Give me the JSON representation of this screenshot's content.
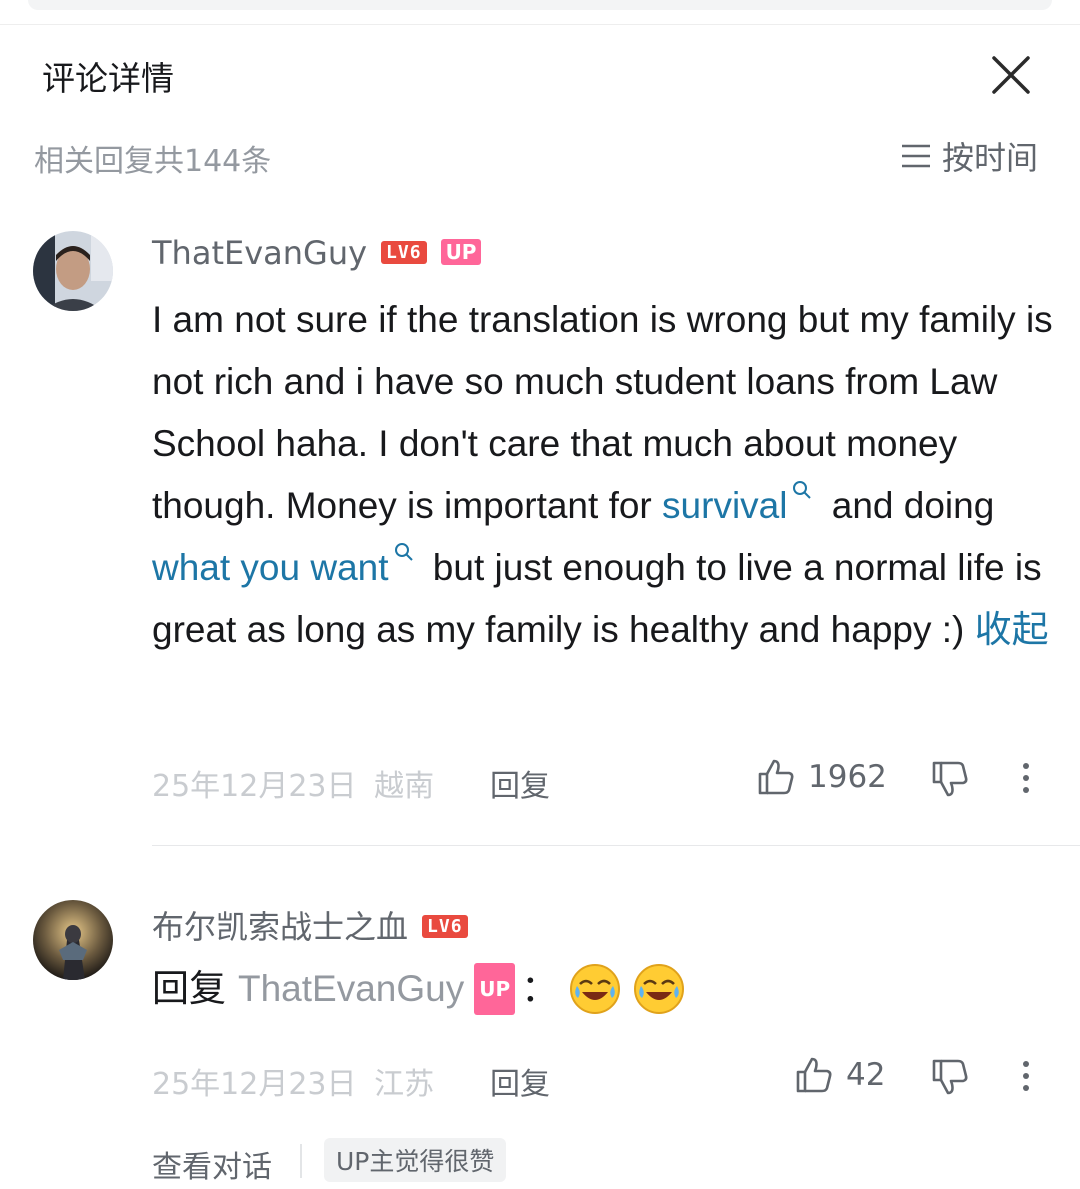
{
  "header": {
    "title": "评论详情"
  },
  "subheader": {
    "reply_count": "相关回复共144条",
    "sort_label": "按时间"
  },
  "comments": [
    {
      "username": "ThatEvanGuy",
      "level": "LV6",
      "up_badge": "UP",
      "text_1": "I am not sure if the translation is wrong but my family is not rich and i have so much student loans from Law School haha. I don't care that much about money though. Money is important for ",
      "link_1": "survival",
      "text_2": " and doing ",
      "link_2": "what you want",
      "text_3": " but just enough to live a normal life is great as long as my family is healthy and happy :) ",
      "collapse": "收起",
      "date": "25年12月23日",
      "location": "越南",
      "reply_label": "回复",
      "likes": "1962"
    },
    {
      "username": "布尔凯索战士之血",
      "level": "LV6",
      "reply_prefix": "回复",
      "reply_target": "ThatEvanGuy",
      "target_badge": "UP",
      "colon": "：",
      "date": "25年12月23日",
      "location": "江苏",
      "reply_label": "回复",
      "likes": "42"
    }
  ],
  "footer": {
    "view_conversation": "查看对话",
    "up_like_tag": "UP主觉得很赞"
  },
  "colors": {
    "link": "#1d76a6",
    "level_badge": "#e94a3f",
    "up_badge": "#ff6699"
  }
}
